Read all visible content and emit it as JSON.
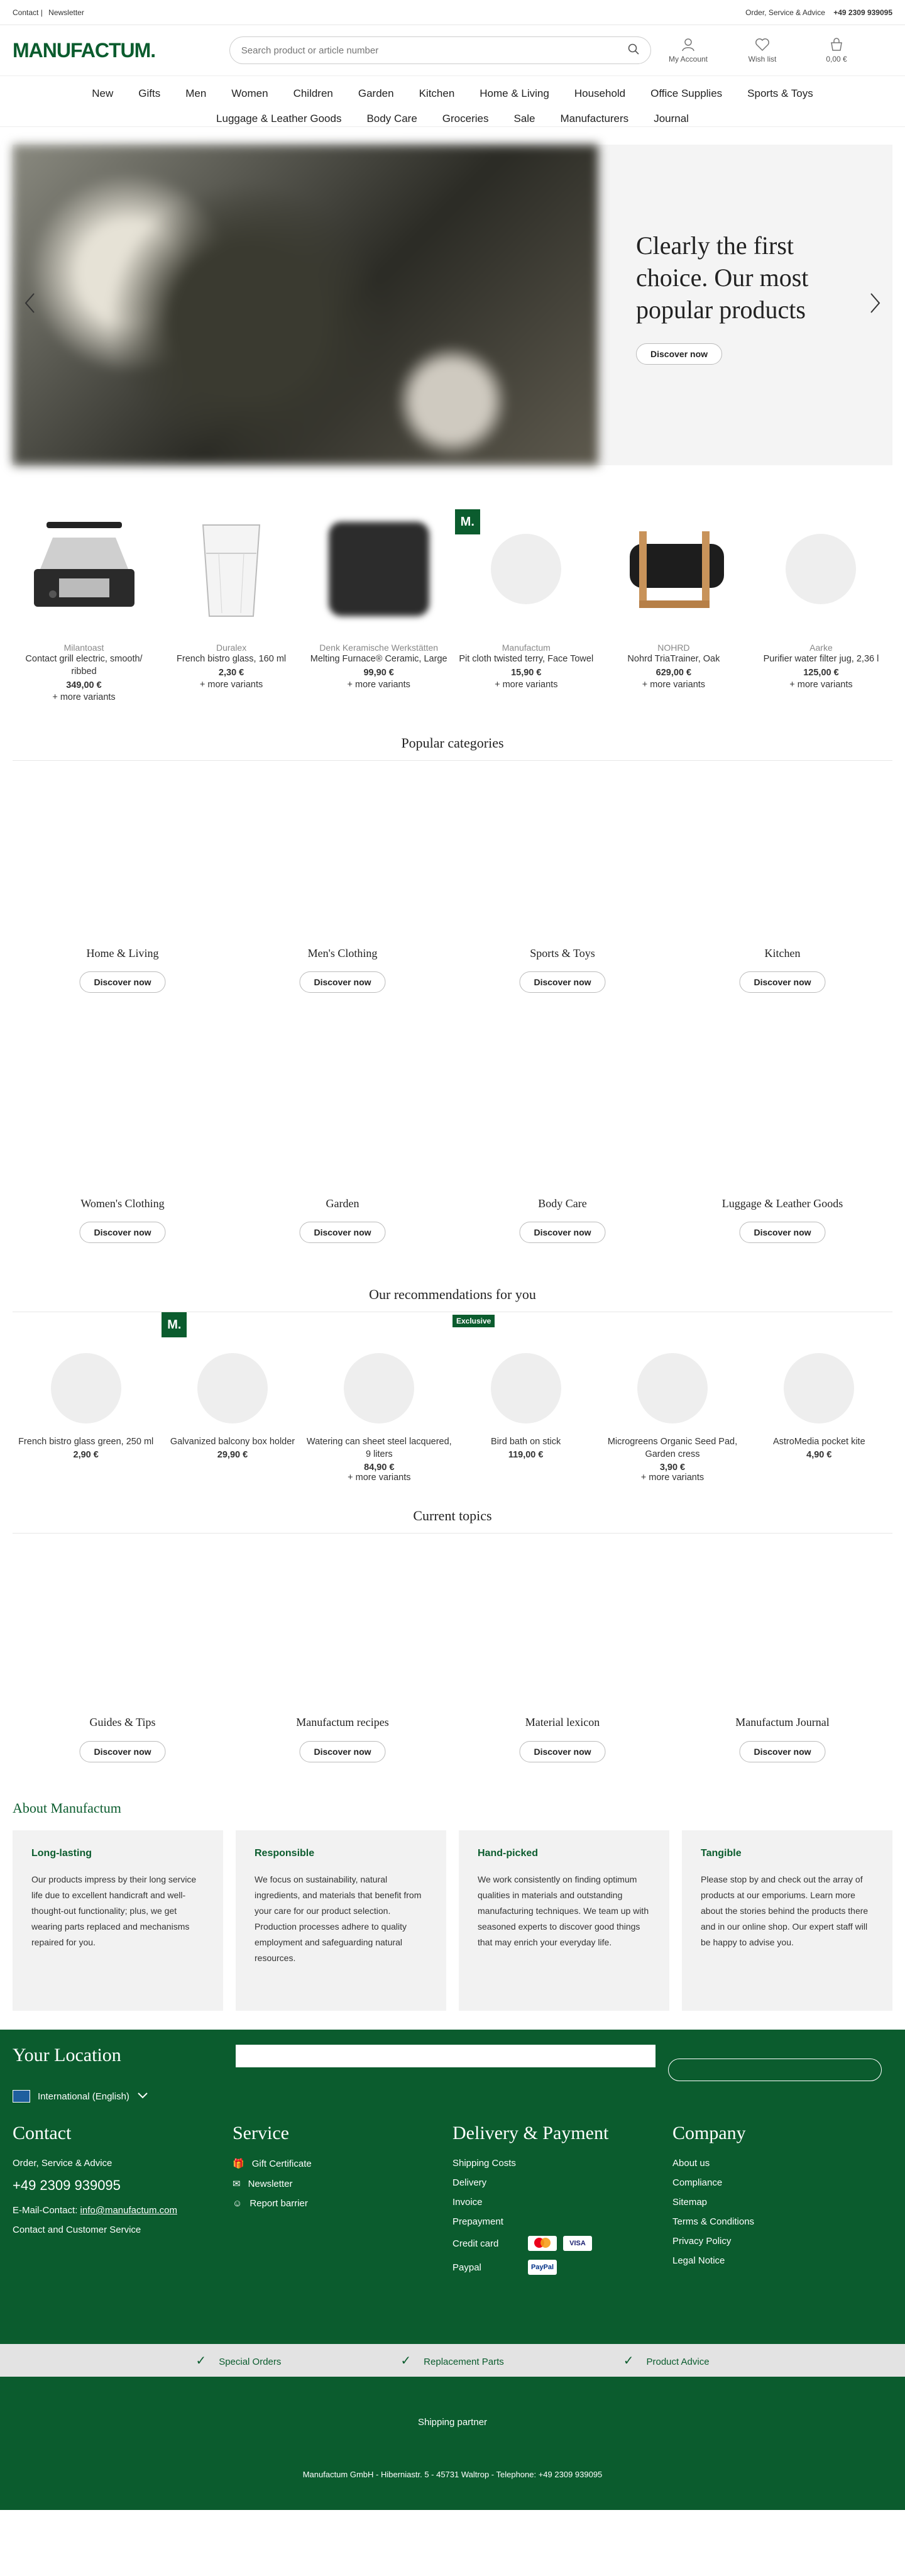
{
  "topbar": {
    "contact": "Contact",
    "sep": "|",
    "newsletter": "Newsletter",
    "order_service": "Order, Service & Advice",
    "phone": "+49 2309 939095"
  },
  "header": {
    "logo": "MANUFACTUM.",
    "search_placeholder": "Search product or article number",
    "account": "My Account",
    "wishlist": "Wish list",
    "cart": "0,00 €"
  },
  "nav": {
    "row1": [
      "New",
      "Gifts",
      "Men",
      "Women",
      "Children",
      "Garden",
      "Kitchen",
      "Home & Living",
      "Household",
      "Office Supplies",
      "Sports & Toys"
    ],
    "row2": [
      "Luggage & Leather Goods",
      "Body Care",
      "Groceries",
      "Sale",
      "Manufacturers",
      "Journal"
    ]
  },
  "hero": {
    "headline": "Clearly the first choice. Our most popular products",
    "button": "Discover now"
  },
  "products": [
    {
      "brand": "Milantoast",
      "name": "Contact grill electric, smooth/ ribbed",
      "price": "349,00 €",
      "more": "+ more variants"
    },
    {
      "brand": "Duralex",
      "name": "French bistro glass, 160 ml",
      "price": "2,30 €",
      "more": "+ more variants"
    },
    {
      "brand": "Denk Keramische Werkstätten",
      "name": "Melting Furnace® Ceramic, Large",
      "price": "99,90 €",
      "more": "+ more variants"
    },
    {
      "brand": "Manufactum",
      "name": "Pit cloth twisted terry, Face Towel",
      "price": "15,90 €",
      "more": "+ more variants",
      "badge": "M."
    },
    {
      "brand": "NOHRD",
      "name": "Nohrd TriaTrainer, Oak",
      "price": "629,00 €",
      "more": "+ more variants"
    },
    {
      "brand": "Aarke",
      "name": "Purifier water filter jug, 2,36 l",
      "price": "125,00 €",
      "more": "+ more variants"
    }
  ],
  "categories_title": "Popular categories",
  "categories": [
    {
      "label": "Home & Living",
      "button": "Discover now"
    },
    {
      "label": "Men's Clothing",
      "button": "Discover now"
    },
    {
      "label": "Sports & Toys",
      "button": "Discover now"
    },
    {
      "label": "Kitchen",
      "button": "Discover now"
    },
    {
      "label": "Women's Clothing",
      "button": "Discover now"
    },
    {
      "label": "Garden",
      "button": "Discover now"
    },
    {
      "label": "Body Care",
      "button": "Discover now"
    },
    {
      "label": "Luggage & Leather Goods",
      "button": "Discover now"
    }
  ],
  "recs_title": "Our recommendations for you",
  "recs": [
    {
      "name": "French bistro glass green, 250 ml",
      "price": "2,90 €",
      "more": ""
    },
    {
      "name": "Galvanized balcony box holder",
      "price": "29,90 €",
      "more": "",
      "badge": "M."
    },
    {
      "name": "Watering can sheet steel lacquered, 9 liters",
      "price": "84,90 €",
      "more": "+ more variants"
    },
    {
      "name": "Bird bath on stick",
      "price": "119,00 €",
      "more": "",
      "exclusive": "Exclusive"
    },
    {
      "name": "Microgreens Organic Seed Pad, Garden cress",
      "price": "3,90 €",
      "more": "+ more variants"
    },
    {
      "name": "AstroMedia pocket kite",
      "price": "4,90 €",
      "more": ""
    }
  ],
  "topics_title": "Current topics",
  "topics": [
    {
      "label": "Guides & Tips",
      "button": "Discover now"
    },
    {
      "label": "Manufactum recipes",
      "button": "Discover now"
    },
    {
      "label": "Material lexicon",
      "button": "Discover now"
    },
    {
      "label": "Manufactum Journal",
      "button": "Discover now"
    }
  ],
  "about": {
    "title": "About Manufactum",
    "cards": [
      {
        "title": "Long-lasting",
        "text": "Our products impress by their long service life due to excellent handicraft and well-thought-out functionality; plus, we get wearing parts replaced and mechanisms repaired for you."
      },
      {
        "title": "Responsible",
        "text": "We focus on sustainability, natural ingredients, and materials that benefit from your care for our product selection. Production processes adhere to quality employment and safeguarding natural resources."
      },
      {
        "title": "Hand-picked",
        "text": "We work consistently on finding optimum qualities in materials and outstanding manufacturing techniques. We team up with seasoned experts to discover good things that may enrich your everyday life."
      },
      {
        "title": "Tangible",
        "text": "Please stop by and check out the array of products at our emporiums. Learn more about the stories behind the products there and in our online shop. Our expert staff will be happy to advise you."
      }
    ]
  },
  "footer": {
    "location_title": "Your Location",
    "language": "International (English)",
    "contact": {
      "title": "Contact",
      "order_service": "Order, Service & Advice",
      "phone": "+49 2309 939095",
      "email_label": "E-Mail-Contact:",
      "email": "info@manufactum.com",
      "customer_service": "Contact and Customer Service"
    },
    "service": {
      "title": "Service",
      "items": [
        "Gift Certificate",
        "Newsletter",
        "Report barrier"
      ]
    },
    "delivery": {
      "title": "Delivery & Payment",
      "items": [
        "Shipping Costs",
        "Delivery",
        "Invoice",
        "Prepayment",
        "Credit card",
        "Paypal"
      ],
      "visa": "VISA",
      "paypal_logo": "PayPal"
    },
    "company": {
      "title": "Company",
      "items": [
        "About us",
        "Compliance",
        "Sitemap",
        "Terms & Conditions",
        "Privacy Policy",
        "Legal Notice"
      ]
    },
    "strip": [
      "Special Orders",
      "Replacement Parts",
      "Product Advice"
    ],
    "shipping_partner": "Shipping partner",
    "imprint": "Manufactum GmbH - Hiberniastr. 5 - 45731 Waltrop - Telephone: +49 2309 939095"
  },
  "colors": {
    "brand_green": "#0b5c2e"
  }
}
